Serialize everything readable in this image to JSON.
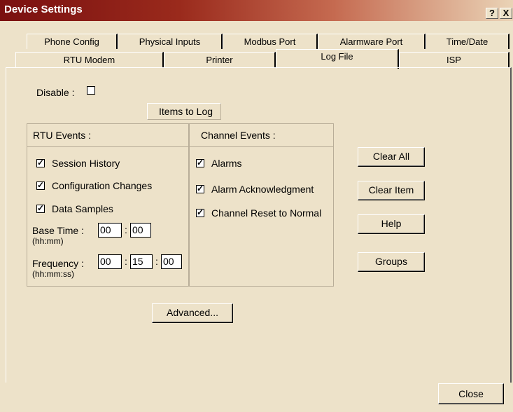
{
  "window": {
    "title": "Device Settings",
    "help_label": "?",
    "close_label": "X"
  },
  "tabs_row1": [
    "Phone Config",
    "Physical Inputs",
    "Modbus Port",
    "Alarmware Port",
    "Time/Date"
  ],
  "tabs_row2": [
    "RTU Modem",
    "Printer",
    "Log File",
    "ISP"
  ],
  "active_tab": "Log File",
  "disable": {
    "label": "Disable :",
    "checked": false
  },
  "items_to_log_label": "Items to Log",
  "rtu_events": {
    "header": "RTU Events :",
    "items": [
      {
        "label": "Session History",
        "checked": true
      },
      {
        "label": "Configuration Changes",
        "checked": true
      },
      {
        "label": "Data Samples",
        "checked": true
      }
    ],
    "base_time": {
      "label": "Base Time :",
      "hint": "(hh:mm)",
      "hh": "00",
      "mm": "00"
    },
    "frequency": {
      "label": "Frequency :",
      "hint": "(hh:mm:ss)",
      "hh": "00",
      "mm": "15",
      "ss": "00"
    }
  },
  "channel_events": {
    "header": "Channel Events :",
    "items": [
      {
        "label": "Alarms",
        "checked": true
      },
      {
        "label": "Alarm Acknowledgment",
        "checked": true
      },
      {
        "label": "Channel Reset to Normal",
        "checked": true
      }
    ]
  },
  "buttons": {
    "clear_all": "Clear All",
    "clear_item": "Clear Item",
    "help": "Help",
    "groups": "Groups",
    "advanced": "Advanced...",
    "close": "Close"
  }
}
